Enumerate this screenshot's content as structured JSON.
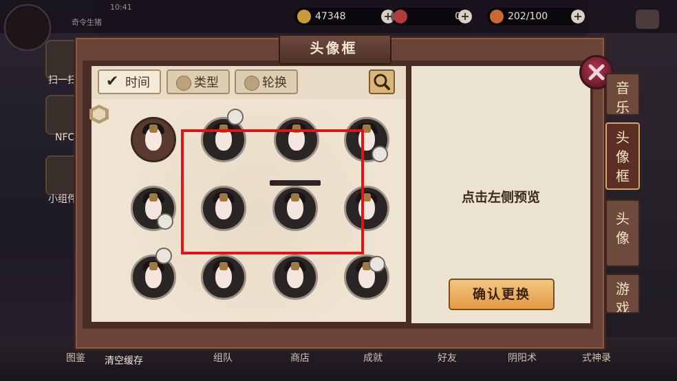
{
  "status_bar": {
    "time": "10:41",
    "subtitle": "奇令生猪"
  },
  "resources": [
    {
      "name": "gold-coin",
      "value": "47348"
    },
    {
      "name": "jade",
      "value": "0"
    },
    {
      "name": "stamina",
      "value": "202/100"
    }
  ],
  "left_menu": {
    "scan": "扫一扫",
    "nfc": "NFC",
    "widgets": "小组件"
  },
  "bottom_menu": [
    "图鉴",
    "清空缓存",
    "组队",
    "商店",
    "成就",
    "好友",
    "阴阳术",
    "式神录"
  ],
  "dialog": {
    "title": "头像框",
    "filters": [
      {
        "label": "时间",
        "checked": true
      },
      {
        "label": "类型",
        "checked": false
      },
      {
        "label": "轮换",
        "checked": false
      }
    ],
    "preview_hint": "点击左侧预览",
    "confirm_label": "确认更换",
    "side_tabs": [
      {
        "label": "音乐",
        "active": false
      },
      {
        "label": "头像框",
        "active": true
      },
      {
        "label": "头像",
        "active": false
      },
      {
        "label": "游戏",
        "active": false
      }
    ]
  },
  "colors": {
    "highlight_box": "#e01414",
    "confirm_button": "#e8a24f",
    "close_button": "#9b2a42"
  }
}
